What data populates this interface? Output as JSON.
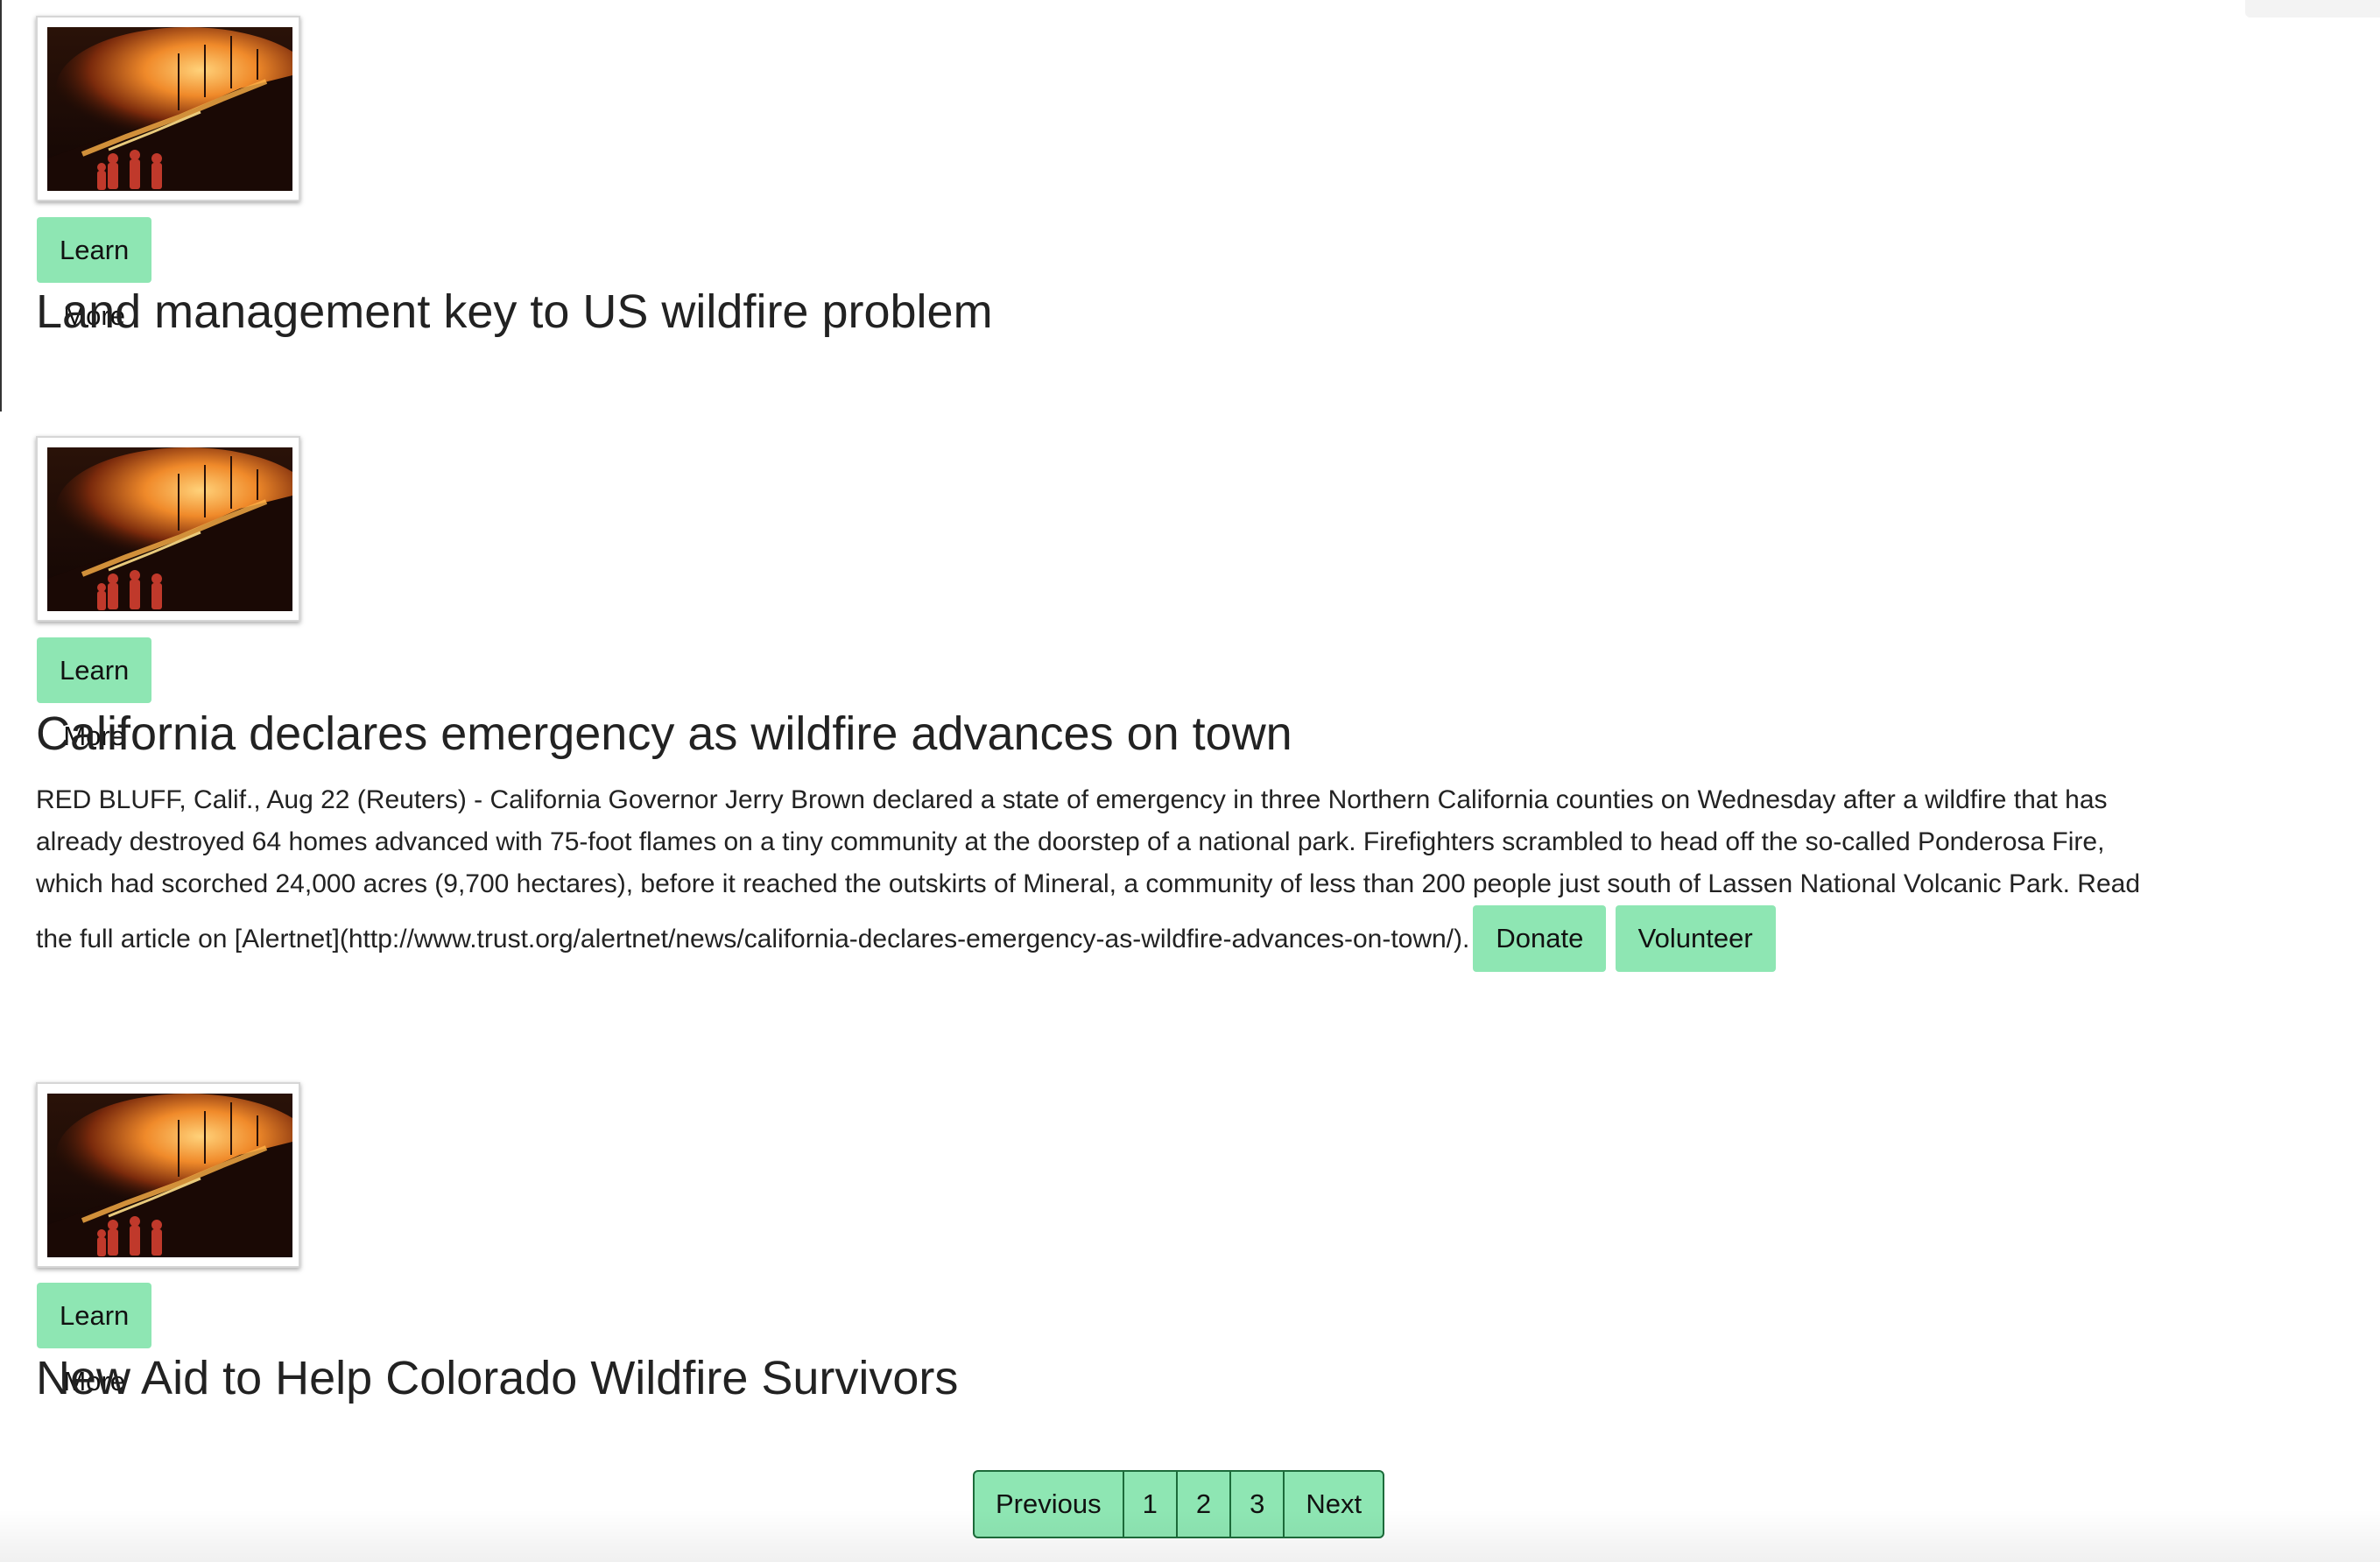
{
  "articles": [
    {
      "image": "wildfire-firefighters-image",
      "learn_more_label": "Learn More",
      "title": "Land management key to US wildfire problem"
    },
    {
      "image": "wildfire-firefighters-image",
      "learn_more_label": "Learn More",
      "title": "California declares emergency as wildfire advances on town",
      "body_lines": [
        "RED BLUFF, Calif., Aug 22 (Reuters) - California Governor Jerry Brown declared a state of emergency in three Northern California counties on Wednesday after a wildfire that has",
        "already destroyed 64 homes advanced with 75-foot flames on a tiny community at the doorstep of a national park. Firefighters scrambled to head off the so-called Ponderosa Fire,",
        "which had scorched 24,000 acres (9,700 hectares), before it reached the outskirts of Mineral, a community of less than 200 people just south of Lassen National Volcanic Park. Read",
        "the full article on [Alertnet](http://www.trust.org/alertnet/news/california-declares-emergency-as-wildfire-advances-on-town/)."
      ],
      "donate_label": "Donate",
      "volunteer_label": "Volunteer"
    },
    {
      "image": "wildfire-firefighters-image",
      "learn_more_label": "Learn More",
      "title": "New Aid to Help Colorado Wildfire Survivors"
    }
  ],
  "pagination": {
    "previous_label": "Previous",
    "pages": [
      "1",
      "2",
      "3"
    ],
    "next_label": "Next"
  },
  "colors": {
    "button_bg": "#8ee6b3",
    "pagination_border": "#1c6b3a",
    "text": "#222222"
  }
}
